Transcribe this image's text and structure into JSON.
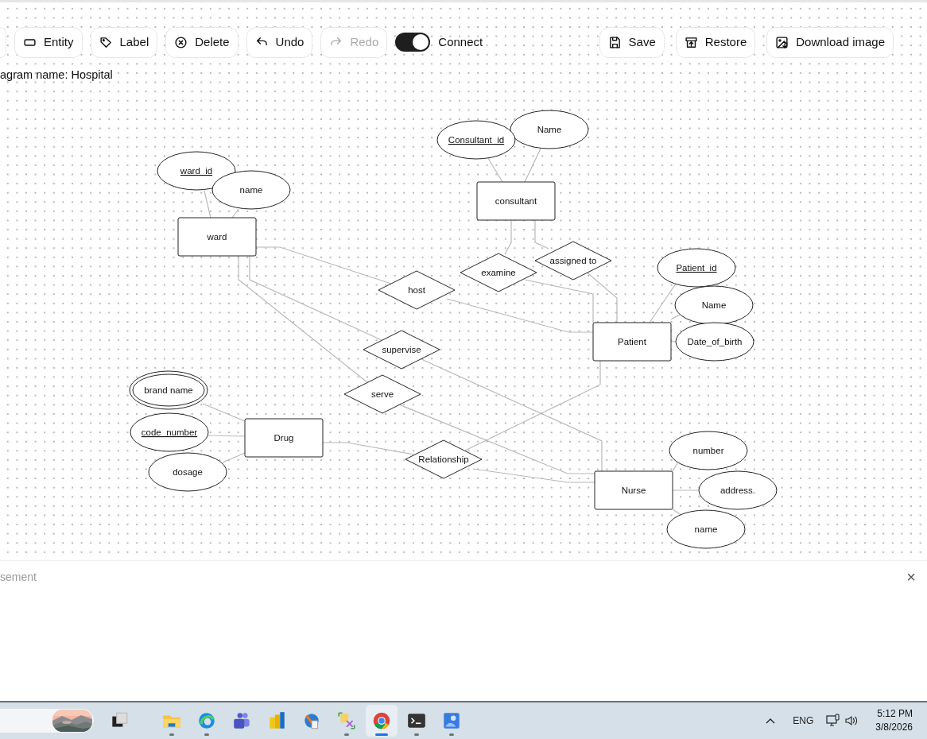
{
  "toolbar": {
    "buttons": [
      {
        "label": "Entity",
        "disabled": false
      },
      {
        "label": "Label",
        "disabled": false
      },
      {
        "label": "Delete",
        "disabled": false
      },
      {
        "label": "Undo",
        "disabled": false
      },
      {
        "label": "Redo",
        "disabled": true
      }
    ],
    "connect": {
      "label": "Connect",
      "on": true
    },
    "right_buttons": [
      {
        "label": "Save"
      },
      {
        "label": "Restore"
      },
      {
        "label": "Download image"
      }
    ]
  },
  "diagram_name": "agram name: Hospital",
  "diagram": {
    "nodes": [
      {
        "kind": "attribute",
        "label": "Name"
      },
      {
        "kind": "key_attribute",
        "label": "Consultant_id"
      },
      {
        "kind": "key_attribute",
        "label": "ward_id"
      },
      {
        "kind": "attribute",
        "label": "name"
      },
      {
        "kind": "entity",
        "label": "consultant"
      },
      {
        "kind": "entity",
        "label": "ward"
      },
      {
        "kind": "relationship",
        "label": "assigned to"
      },
      {
        "kind": "key_attribute",
        "label": "Patient_id"
      },
      {
        "kind": "relationship",
        "label": "examine"
      },
      {
        "kind": "relationship",
        "label": "host"
      },
      {
        "kind": "attribute",
        "label": "Name"
      },
      {
        "kind": "entity",
        "label": "Patient"
      },
      {
        "kind": "attribute",
        "label": "Date_of_birth"
      },
      {
        "kind": "relationship",
        "label": "supervise"
      },
      {
        "kind": "multivalued_attribute",
        "label": "brand name"
      },
      {
        "kind": "relationship",
        "label": "serve"
      },
      {
        "kind": "key_attribute",
        "label": "code_number"
      },
      {
        "kind": "entity",
        "label": "Drug"
      },
      {
        "kind": "attribute",
        "label": "number"
      },
      {
        "kind": "relationship",
        "label": "Relationship"
      },
      {
        "kind": "attribute",
        "label": "dosage"
      },
      {
        "kind": "entity",
        "label": "Nurse"
      },
      {
        "kind": "attribute",
        "label": "address."
      },
      {
        "kind": "attribute",
        "label": "name"
      }
    ]
  },
  "bottom_panel": {
    "text": "sement",
    "close": "×"
  },
  "taskbar": {
    "apps": [
      {
        "running": false,
        "selected": false
      },
      {
        "running": true,
        "selected": false
      },
      {
        "running": true,
        "selected": false
      },
      {
        "running": false,
        "selected": false
      },
      {
        "running": false,
        "selected": false
      },
      {
        "running": false,
        "selected": false
      },
      {
        "running": true,
        "selected": false
      },
      {
        "running": true,
        "selected": true
      },
      {
        "running": true,
        "selected": false
      },
      {
        "running": true,
        "selected": false
      }
    ],
    "language": "ENG",
    "time": "5:12 PM",
    "date": "3/8/2026"
  }
}
